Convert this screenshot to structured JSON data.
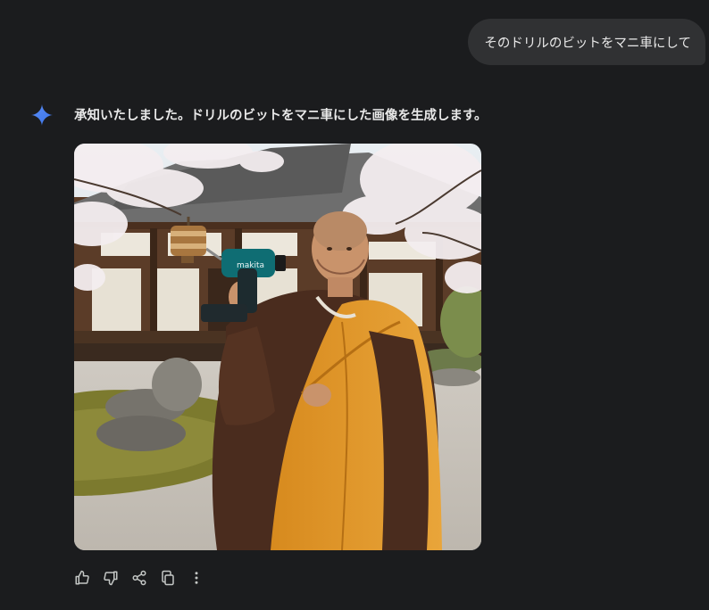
{
  "user_message": {
    "text": "そのドリルのビットをマニ車にして"
  },
  "assistant": {
    "icon": "gemini-spark-icon",
    "reply_text": "承知いたしました。ドリルのビットをマニ車にした画像を生成します。",
    "image": {
      "drill_brand": "makita"
    }
  },
  "actions": [
    {
      "name": "thumbs-up-icon"
    },
    {
      "name": "thumbs-down-icon"
    },
    {
      "name": "share-icon"
    },
    {
      "name": "copy-icon"
    },
    {
      "name": "more-vert-icon"
    }
  ],
  "colors": {
    "background": "#1b1c1e",
    "bubble": "#303133",
    "accent_blue": "#4285f4"
  }
}
